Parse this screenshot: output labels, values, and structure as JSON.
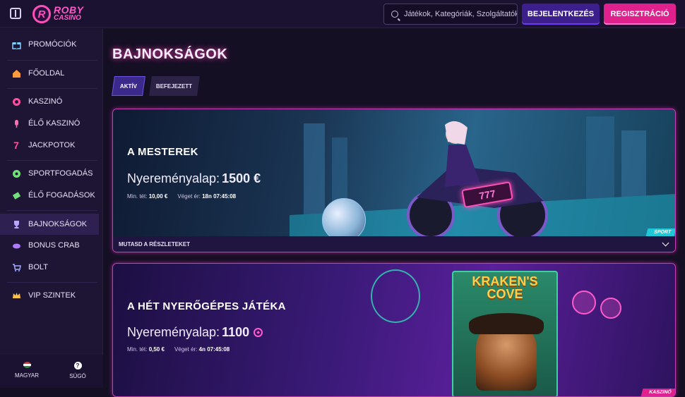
{
  "header": {
    "logo_line1": "ROBY",
    "logo_line2": "CASINO",
    "logo_letter": "R",
    "search_placeholder": "Játékok, Kategóriák, Szolgáltatók",
    "login_label": "BEJELENTKEZÉS",
    "register_label": "REGISZTRÁCIÓ"
  },
  "sidebar": {
    "items": [
      {
        "label": "PROMÓCIÓK",
        "icon": "gift-icon"
      },
      {
        "label": "FŐOLDAL",
        "icon": "home-icon"
      },
      {
        "label": "KASZINÓ",
        "icon": "chip-icon"
      },
      {
        "label": "ÉLŐ KASZINÓ",
        "icon": "microphone-icon"
      },
      {
        "label": "JACKPOTOK",
        "icon": "seven-icon"
      },
      {
        "label": "SPORTFOGADÁS",
        "icon": "soccer-ball-icon"
      },
      {
        "label": "ÉLŐ FOGADÁSOK",
        "icon": "ticket-icon"
      },
      {
        "label": "BAJNOKSÁGOK",
        "icon": "trophy-icon"
      },
      {
        "label": "BONUS CRAB",
        "icon": "crab-icon"
      },
      {
        "label": "BOLT",
        "icon": "cart-icon"
      },
      {
        "label": "VIP SZINTEK",
        "icon": "crown-icon"
      }
    ],
    "active": "BAJNOKSÁGOK",
    "language_label": "MAGYAR",
    "help_label": "SÚGÓ",
    "help_glyph": "?"
  },
  "main": {
    "title": "BAJNOKSÁGOK",
    "tabs": [
      {
        "label": "AKTÍV",
        "active": true
      },
      {
        "label": "BEFEJEZETT",
        "active": false
      }
    ],
    "tournaments": [
      {
        "title": "A MESTEREK",
        "prize_label": "Nyereményalap:",
        "prize_amount": "1500 €",
        "min_bet_label": "Min. tét:",
        "min_bet": "10,00 €",
        "ends_label": "Véget ér:",
        "ends": "18n 07:45:08",
        "footer": "MUTASD A RÉSZLETEKET",
        "badge": "SPORT",
        "art_sign": "777"
      },
      {
        "title": "A HÉT NYERŐGÉPES JÁTÉKA",
        "prize_label": "Nyereményalap:",
        "prize_amount": "1100",
        "min_bet_label": "Min. tét:",
        "min_bet": "0,50 €",
        "ends_label": "Véget ér:",
        "ends": "4n 07:45:08",
        "badge": "KASZINÓ",
        "art_title": "KRAKEN'S COVE"
      }
    ]
  },
  "colors": {
    "accent_pink": "#e0208c",
    "accent_purple": "#3c1e8c",
    "sport_badge": "#1ec8d8"
  }
}
